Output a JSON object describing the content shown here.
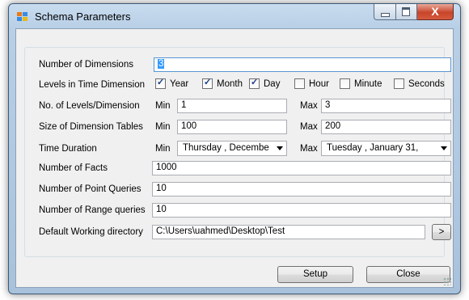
{
  "window": {
    "title": "Schema Parameters",
    "icon": "schema-app-icon"
  },
  "title_controls": {
    "minimize": "minimize-icon",
    "maximize": "maximize-icon",
    "close": "X"
  },
  "fields": {
    "dimensions": {
      "label": "Number of Dimensions",
      "value": "3"
    },
    "time_levels": {
      "label": "Levels in Time Dimension",
      "options": [
        {
          "label": "Year",
          "checked": true
        },
        {
          "label": "Month",
          "checked": true
        },
        {
          "label": "Day",
          "checked": true
        },
        {
          "label": "Hour",
          "checked": false
        },
        {
          "label": "Minute",
          "checked": false
        },
        {
          "label": "Seconds",
          "checked": false
        }
      ]
    },
    "levels_per_dimension": {
      "label": "No. of Levels/Dimension",
      "min_label": "Min",
      "min": "1",
      "max_label": "Max",
      "max": "3"
    },
    "dimension_table_size": {
      "label": "Size of Dimension Tables",
      "min_label": "Min",
      "min": "100",
      "max_label": "Max",
      "max": "200"
    },
    "time_duration": {
      "label": "Time Duration",
      "min_label": "Min",
      "min": "Thursday , Decembe",
      "max_label": "Max",
      "max": "Tuesday , January 31,"
    },
    "facts": {
      "label": "Number of Facts",
      "value": "1000"
    },
    "point_queries": {
      "label": "Number of Point Queries",
      "value": "10"
    },
    "range_queries": {
      "label": "Number of Range queries",
      "value": "10"
    },
    "working_dir": {
      "label": "Default Working directory",
      "value": "C:\\Users\\uahmed\\Desktop\\Test",
      "browse": ">"
    }
  },
  "buttons": {
    "setup": "Setup",
    "close": "Close"
  }
}
